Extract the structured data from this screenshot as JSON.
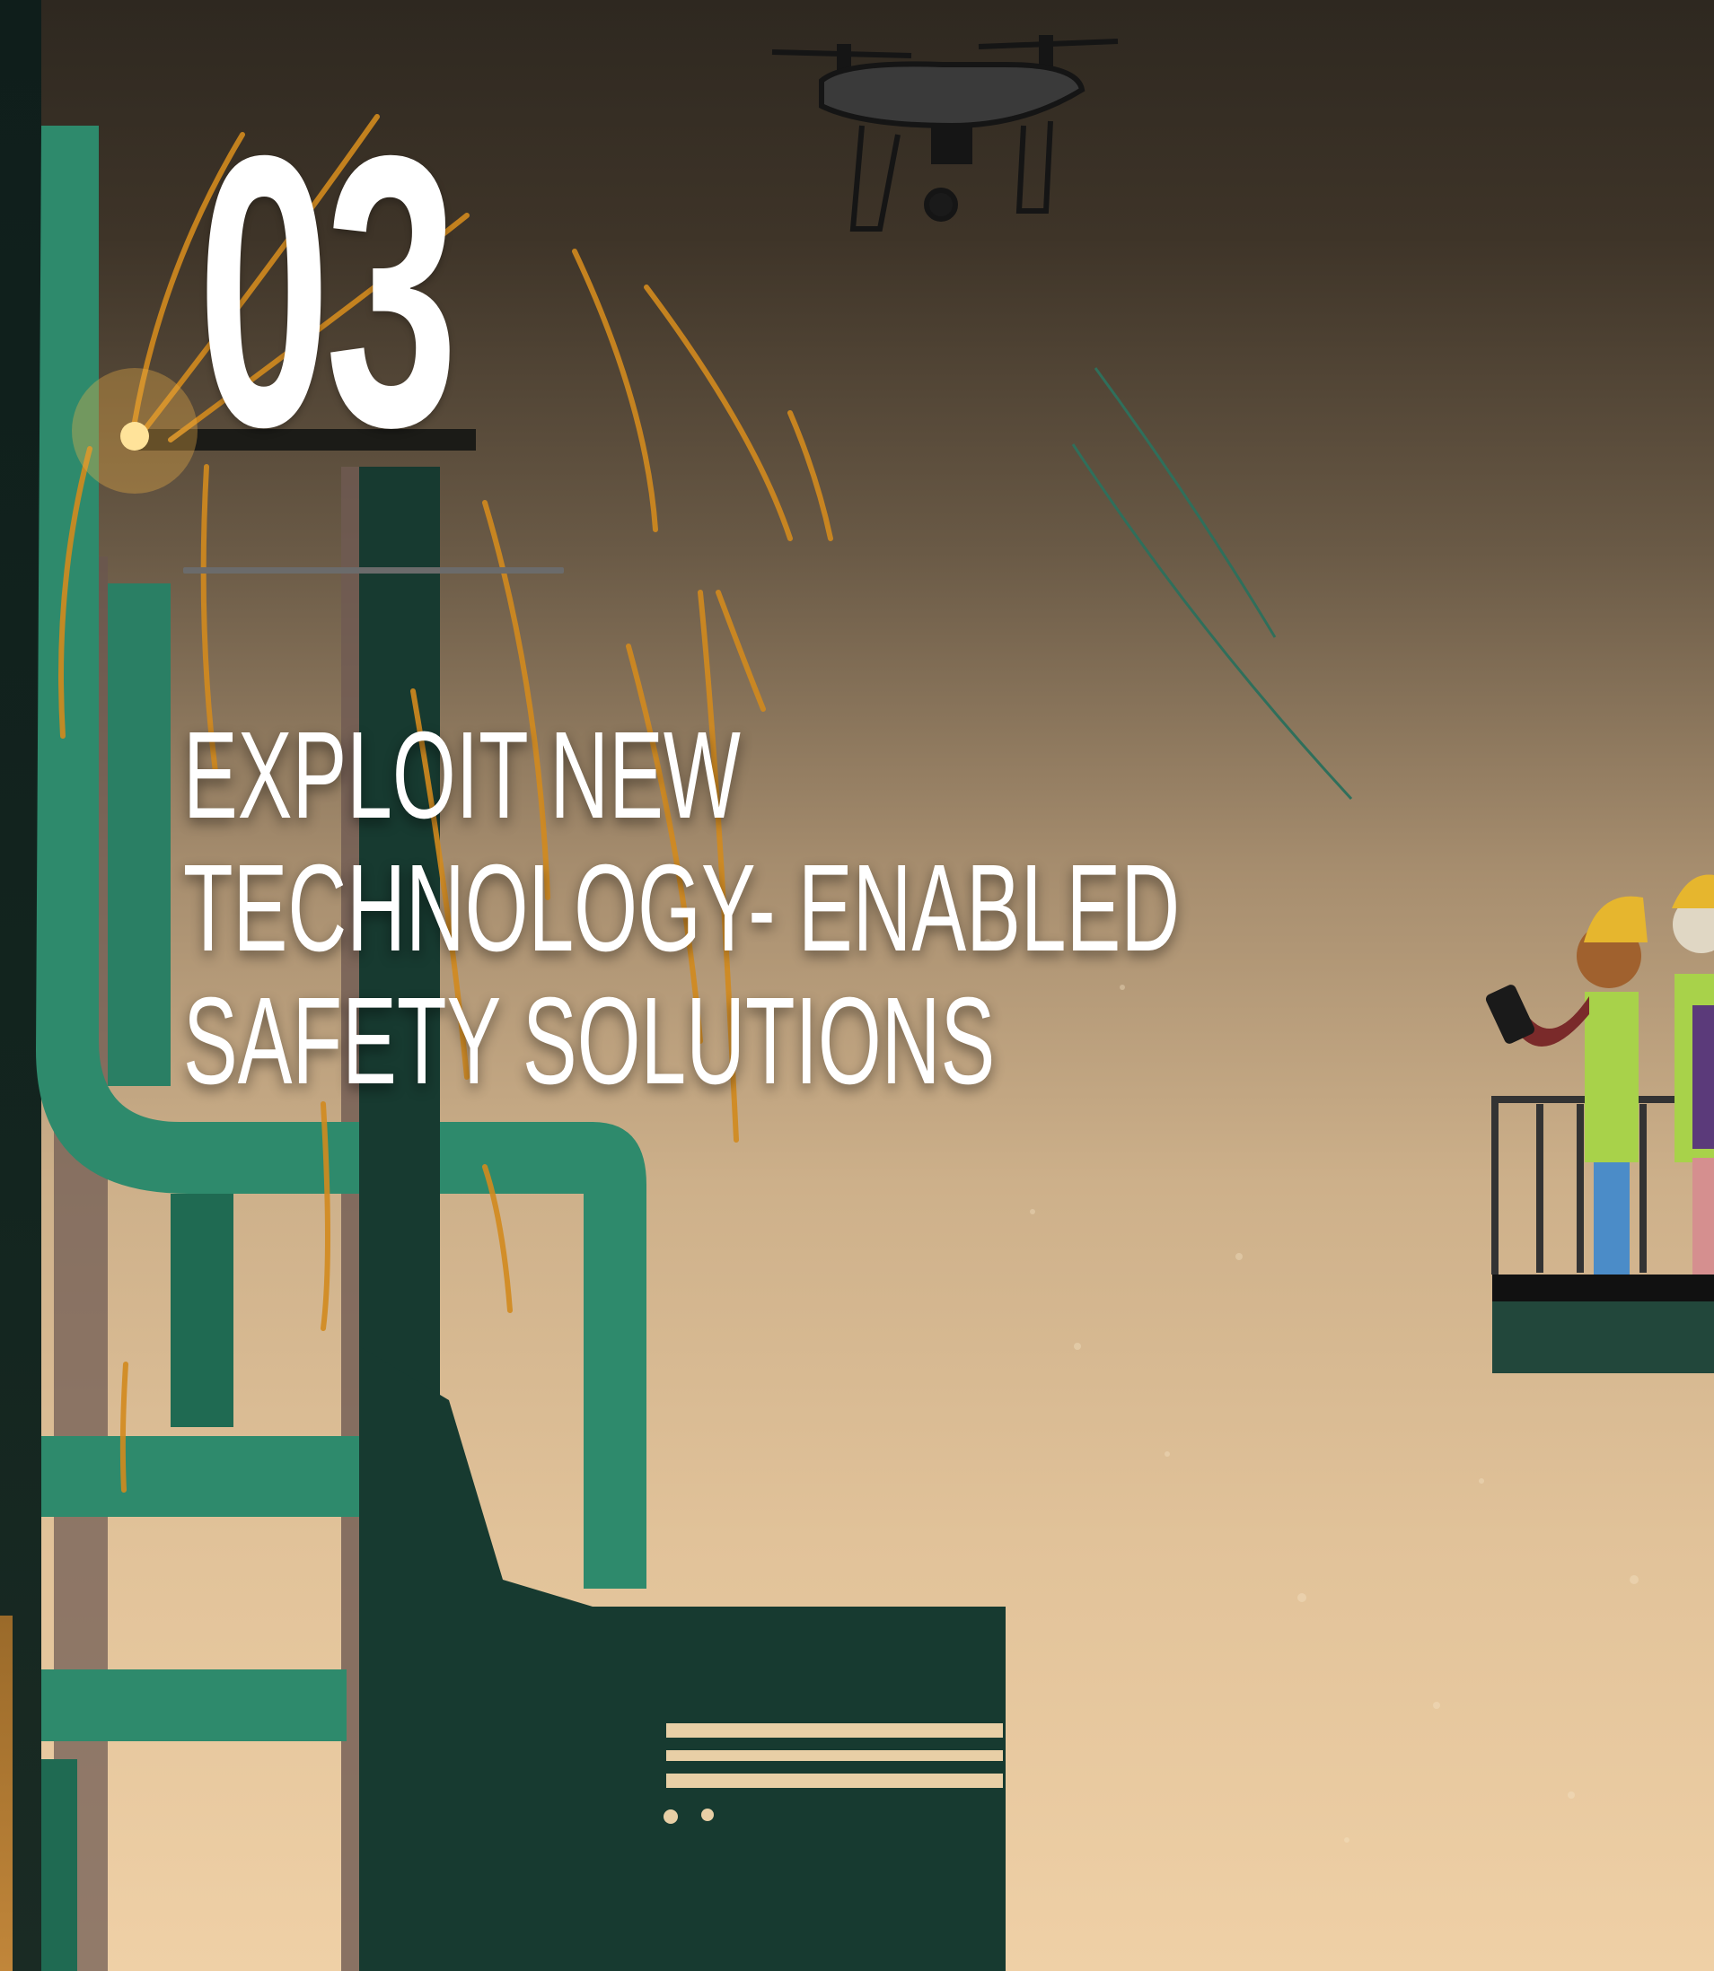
{
  "page": {
    "section_number": "03",
    "headline_lines": [
      "EXPLOIT NEW",
      "TECHNOLOGY- ENABLED",
      "SAFETY SOLUTIONS"
    ]
  },
  "illustration": {
    "elements": [
      "drone-icon",
      "industrial-pipes",
      "welding-sparks",
      "signal-lines",
      "workers-on-platform",
      "smartphone-icon",
      "hard-hat-icon"
    ]
  },
  "colors": {
    "pipe_green": "#2e8a6c",
    "dark_green": "#173a30",
    "spark_orange": "#d28a1e",
    "hard_hat_yellow": "#e6b62e",
    "vest_green": "#a8d24a",
    "text_white": "#ffffff",
    "divider_gray": "#6b6b6b"
  }
}
